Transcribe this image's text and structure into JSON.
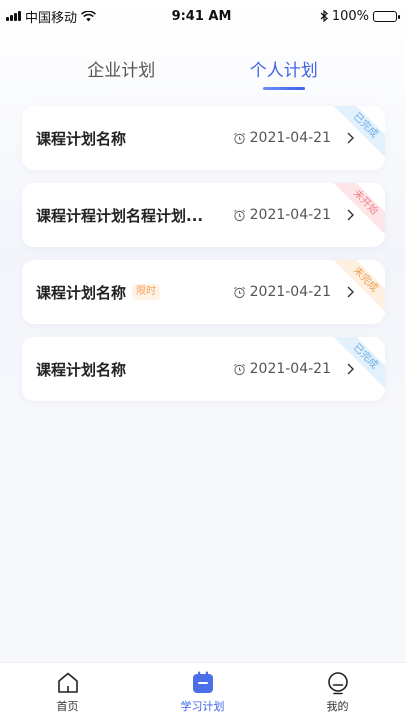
{
  "status_bar": {
    "carrier": "中国移动",
    "time": "9:41 AM",
    "battery": "100%"
  },
  "tabs": [
    {
      "label": "企业计划",
      "active": false
    },
    {
      "label": "个人计划",
      "active": true
    }
  ],
  "plans": [
    {
      "title": "课程计划名称",
      "badge": "",
      "date": "2021-04-21",
      "status": "已完成"
    },
    {
      "title": "课程计程计划名程计划...",
      "badge": "",
      "date": "2021-04-21",
      "status": "未开始"
    },
    {
      "title": "课程计划名称",
      "badge": "限时",
      "date": "2021-04-21",
      "status": "未完成"
    },
    {
      "title": "课程计划名称",
      "badge": "",
      "date": "2021-04-21",
      "status": "已完成"
    }
  ],
  "bottom_nav": [
    {
      "label": "首页",
      "icon": "home-icon",
      "active": false
    },
    {
      "label": "学习计划",
      "icon": "calendar-icon",
      "active": true
    },
    {
      "label": "我的",
      "icon": "profile-icon",
      "active": false
    }
  ],
  "colors": {
    "accent": "#3d63e6",
    "done": "#6aaee8",
    "not_started": "#ef7b83",
    "unfinished": "#ef9f4e"
  }
}
